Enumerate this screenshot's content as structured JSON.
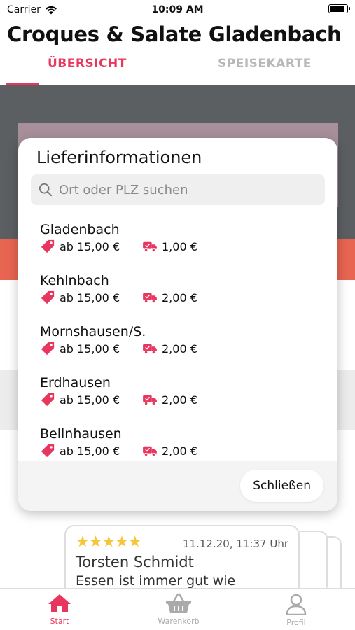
{
  "status_bar": {
    "carrier": "Carrier",
    "time": "10:09 AM"
  },
  "app": {
    "title": "Croques & Salate Gladenbach"
  },
  "tabs": [
    {
      "label": "ÜBERSICHT",
      "active": true
    },
    {
      "label": "SPEISEKARTE",
      "active": false
    }
  ],
  "review": {
    "rating": 5,
    "stars": "★★★★★",
    "date": "11.12.20, 11:37 Uhr",
    "author": "Torsten Schmidt",
    "text": "Essen ist immer gut wie"
  },
  "modal": {
    "title": "Lieferinformationen",
    "search_placeholder": "Ort oder PLZ suchen",
    "close_label": "Schließen",
    "locations": [
      {
        "name": "Gladenbach",
        "min_order": "ab 15,00 €",
        "delivery_fee": "1,00 €"
      },
      {
        "name": "Kehlnbach",
        "min_order": "ab 15,00 €",
        "delivery_fee": "2,00 €"
      },
      {
        "name": "Mornshausen/S.",
        "min_order": "ab 15,00 €",
        "delivery_fee": "2,00 €"
      },
      {
        "name": "Erdhausen",
        "min_order": "ab 15,00 €",
        "delivery_fee": "2,00 €"
      },
      {
        "name": "Bellnhausen",
        "min_order": "ab 15,00 €",
        "delivery_fee": "2,00 €"
      }
    ]
  },
  "tabbar": {
    "start": "Start",
    "cart": "Warenkorb",
    "profile": "Profil"
  },
  "colors": {
    "accent": "#e8375f",
    "orange": "#e86552",
    "star": "#f6c63a"
  }
}
